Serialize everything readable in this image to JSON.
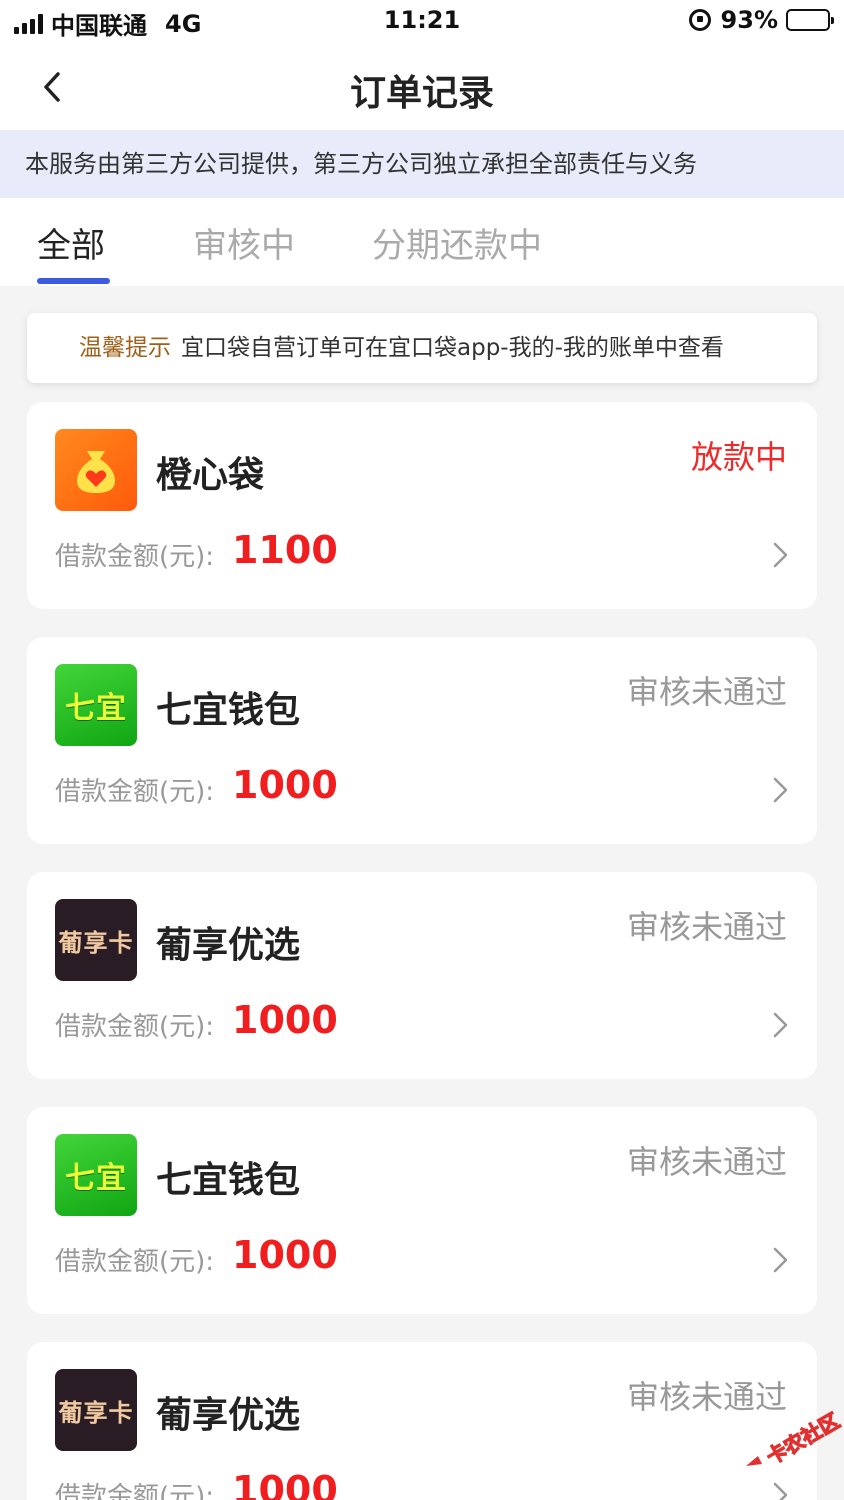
{
  "status_bar": {
    "carrier": "中国联通",
    "network": "4G",
    "time": "11:21",
    "battery": "93%",
    "battery_level": 0.93
  },
  "nav": {
    "title": "订单记录"
  },
  "notice": {
    "text": "本服务由第三方公司提供，第三方公司独立承担全部责任与义务"
  },
  "tabs": [
    {
      "label": "全部",
      "active": true
    },
    {
      "label": "审核中",
      "active": false
    },
    {
      "label": "分期还款中",
      "active": false
    }
  ],
  "tip": {
    "label": "温馨提示",
    "text": "宜口袋自营订单可在宜口袋app-我的-我的账单中查看"
  },
  "orders": [
    {
      "name": "橙心袋",
      "status": "放款中",
      "amount_label": "借款金额(元):",
      "amount": "1100",
      "logo": "orange-money-bag-icon"
    },
    {
      "name": "七宜钱包",
      "status": "审核未通过",
      "amount_label": "借款金额(元):",
      "amount": "1000",
      "logo": "qiyi-logo",
      "logo_text": "七宜"
    },
    {
      "name": "葡享优选",
      "status": "审核未通过",
      "amount_label": "借款金额(元):",
      "amount": "1000",
      "logo": "puxiang-logo",
      "logo_text": "葡享卡"
    },
    {
      "name": "七宜钱包",
      "status": "审核未通过",
      "amount_label": "借款金额(元):",
      "amount": "1000",
      "logo": "qiyi-logo",
      "logo_text": "七宜"
    },
    {
      "name": "葡享优选",
      "status": "审核未通过",
      "amount_label": "借款金额(元):",
      "amount": "1000",
      "logo": "puxiang-logo",
      "logo_text": "葡享卡"
    }
  ],
  "colors": {
    "accent": "#3d5be0",
    "amount_red": "#f01e1e",
    "notice_bg": "#e8ebfa",
    "tip_label": "#a0601a"
  },
  "watermark": {
    "text": "卡农社区"
  }
}
